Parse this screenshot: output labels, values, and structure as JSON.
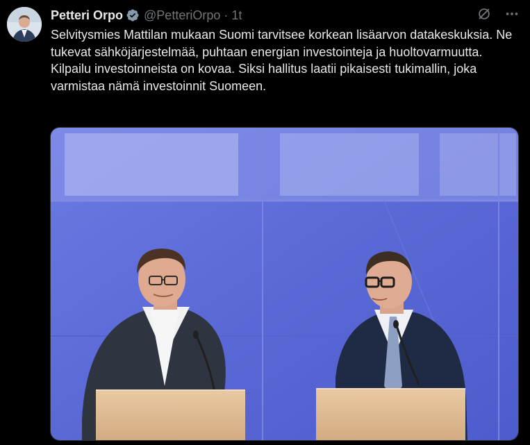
{
  "author": {
    "display_name": "Petteri Orpo",
    "handle": "@PetteriOrpo",
    "separator": "·",
    "time": "1t",
    "verified": true
  },
  "icons": {
    "avatar": "profile-photo",
    "verified": "verified-badge-icon",
    "grok": "grok-icon",
    "more": "more-options-icon"
  },
  "tweet": {
    "text": "Selvitysmies Mattilan mukaan Suomi tarvitsee korkean lisäarvon datakeskuksia. Ne tukevat sähköjärjestelmää, puhtaan energian investointeja ja huoltovarmuutta. Kilpailu investoinneista on kovaa. Siksi hallitus laatii pikaisesti tukimallin, joka varmistaa nämä investoinnit Suomeen."
  },
  "colors": {
    "background": "#000000",
    "text": "#e7e9ea",
    "muted": "#71767b",
    "verified": "#829aab",
    "photo_backdrop": "#5d6bd8"
  }
}
